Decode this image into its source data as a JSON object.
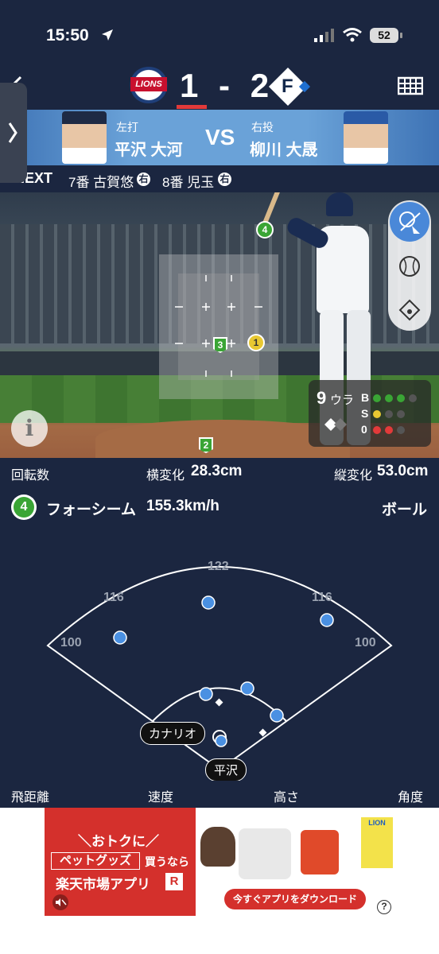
{
  "status_bar": {
    "time": "15:50",
    "battery": "52"
  },
  "header": {
    "home_score": "1",
    "dash": "-",
    "away_score": "2",
    "home_team": "Lions",
    "home_logo_text": "LIONS",
    "away_logo_text": "F"
  },
  "matchup": {
    "batter_side": "左打",
    "batter_name": "平沢 大河",
    "vs": "VS",
    "pitcher_side": "右投",
    "pitcher_name": "柳川 大晟"
  },
  "next_batters": {
    "label": "NEXT",
    "batter1": "7番 古賀悠",
    "batter1_hand": "右",
    "batter2": "8番 児玉",
    "batter2_hand": "右"
  },
  "pitch_zone": {
    "pitch_markers": [
      {
        "label": "4",
        "color": "#3aa535"
      },
      {
        "label": "3",
        "color": "#3aa535"
      },
      {
        "label": "1",
        "color": "#e8c832"
      },
      {
        "label": "2",
        "color": "#3aa535"
      }
    ]
  },
  "count_panel": {
    "inning": "9",
    "half": "ウラ",
    "b_label": "B",
    "s_label": "S",
    "o_label": "0",
    "balls": 3,
    "strikes": 1,
    "outs": 2
  },
  "pitch_stats": {
    "spin_label": "回転数",
    "h_break_label": "横変化",
    "h_break_value": "28.3cm",
    "v_break_label": "縦変化",
    "v_break_value": "53.0cm",
    "pitch_number": "4",
    "pitch_type": "フォーシーム",
    "pitch_speed": "155.3km/h",
    "result": "ボール"
  },
  "spray_chart": {
    "distances": {
      "center": "122",
      "left_center": "116",
      "right_center": "116",
      "left": "100",
      "right": "100"
    },
    "fielder_label": "カナリオ",
    "batter_label": "平沢"
  },
  "spray_footer": {
    "distance": "飛距離",
    "speed": "速度",
    "height": "高さ",
    "angle": "角度"
  },
  "ad": {
    "line1": "＼おトクに／",
    "line2a": "ペットグッズ",
    "line2b": "買うなら",
    "line3": "楽天市場アプリ",
    "line3_badge": "R",
    "cta": "今すぐアプリをダウンロード",
    "brand": "LION",
    "help": "?"
  },
  "colors": {
    "navy": "#1b2640",
    "blue_dot": "#4a90e2",
    "green": "#3aa535",
    "yellow": "#e8c832",
    "red": "#e23a3a",
    "ad_red": "#d4302c"
  }
}
